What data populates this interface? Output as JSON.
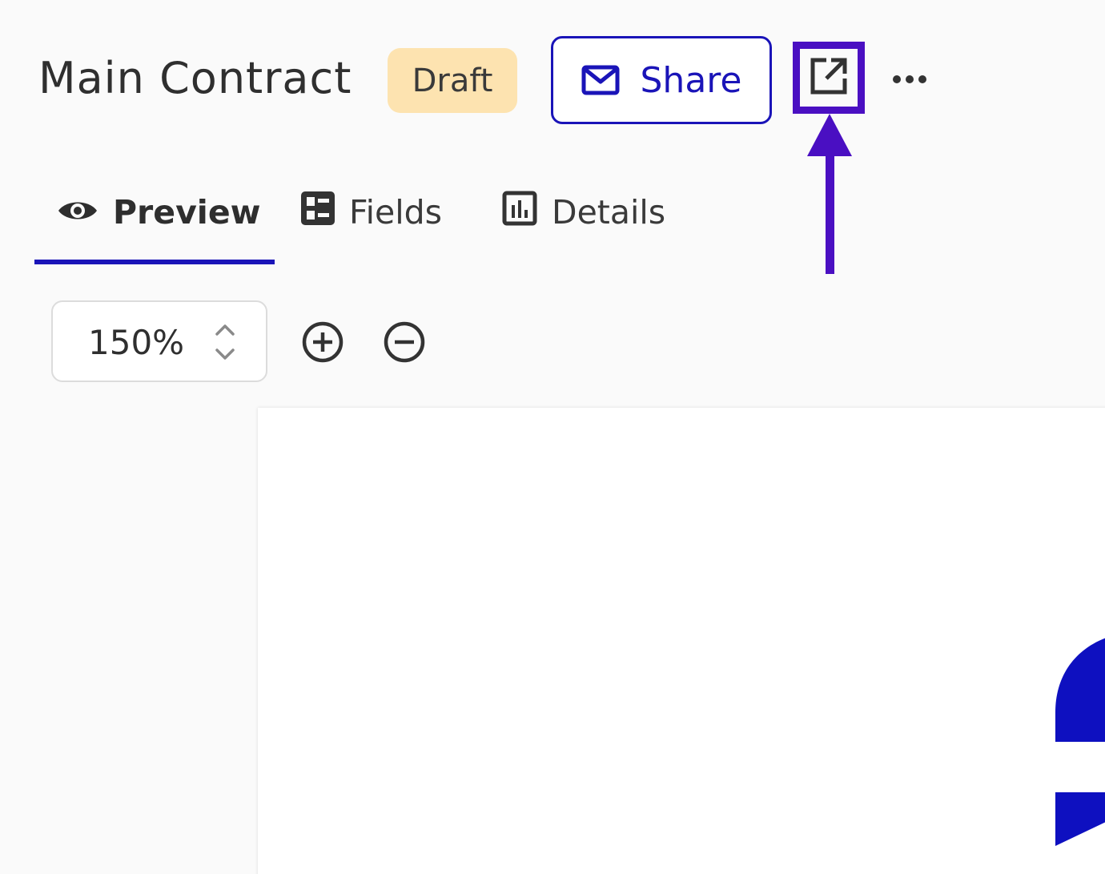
{
  "header": {
    "title": "Main Contract",
    "status": "Draft",
    "share_label": "Share"
  },
  "tabs": [
    {
      "label": "Preview",
      "icon": "eye-icon",
      "active": true
    },
    {
      "label": "Fields",
      "icon": "fields-icon",
      "active": false
    },
    {
      "label": "Details",
      "icon": "chart-icon",
      "active": false
    }
  ],
  "zoom": {
    "value": "150%"
  },
  "icons": {
    "share": "mail-icon",
    "open_external": "external-link-icon",
    "more": "more-horizontal-icon",
    "zoom_in": "plus-circle-icon",
    "zoom_out": "minus-circle-icon"
  },
  "colors": {
    "accent": "#1a14b8",
    "highlight": "#4a0fc2",
    "badge_bg": "#fde3b0",
    "background": "#fafafa"
  }
}
